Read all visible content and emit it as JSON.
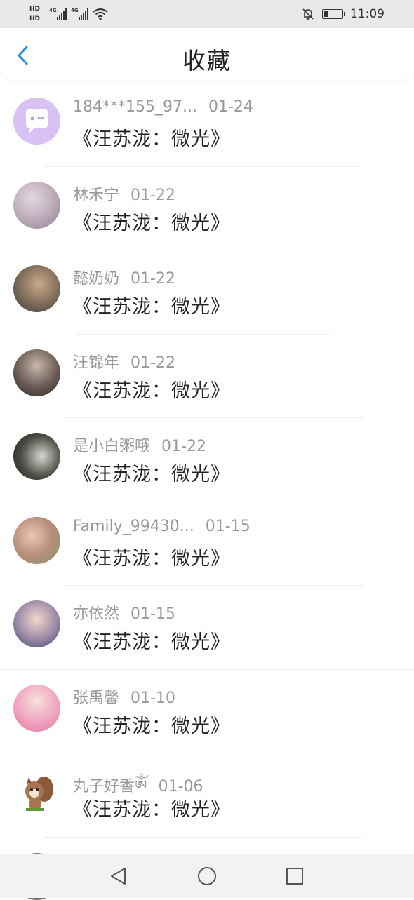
{
  "status_bar": {
    "hd_top": "HD",
    "hd_bottom": "HD",
    "network1": "4G",
    "network2": "4G",
    "time": "11:09"
  },
  "header": {
    "title": "收藏"
  },
  "items": [
    {
      "name": "184***155_97...",
      "date": "01-24",
      "work": "《汪苏泷：微光》",
      "avatar": "chat-bubble-avatar",
      "color": "#d7c2f3"
    },
    {
      "name": "林禾宁",
      "date": "01-22",
      "work": "《汪苏泷：微光》",
      "avatar": "user-avatar",
      "color": "#c9b8c6"
    },
    {
      "name": "懿奶奶",
      "date": "01-22",
      "work": "《汪苏泷：微光》",
      "avatar": "user-avatar",
      "color": "#7c6a58"
    },
    {
      "name": "汪锦年",
      "date": "01-22",
      "work": "《汪苏泷：微光》",
      "avatar": "user-avatar",
      "color": "#6b5a55"
    },
    {
      "name": "是小白粥哦",
      "date": "01-22",
      "work": "《汪苏泷：微光》",
      "avatar": "user-avatar",
      "color": "#4b4f45"
    },
    {
      "name": "Family_99430...",
      "date": "01-15",
      "work": "《汪苏泷：微光》",
      "avatar": "user-avatar",
      "color": "#b98c7a"
    },
    {
      "name": "亦依然",
      "date": "01-15",
      "work": "《汪苏泷：微光》",
      "avatar": "user-avatar",
      "color": "#5d6b8a"
    },
    {
      "name": "张禹馨",
      "date": "01-10",
      "work": "《汪苏泷：微光》",
      "avatar": "user-avatar",
      "color": "#f1a3c0"
    },
    {
      "name": "丸子好香ༀ",
      "date": "01-06",
      "work": "《汪苏泷：微光》",
      "avatar": "user-avatar",
      "color": "#8a5a3a"
    }
  ],
  "nav": {
    "back": "back-triangle-icon",
    "home": "home-circle-icon",
    "recent": "recent-square-icon"
  }
}
